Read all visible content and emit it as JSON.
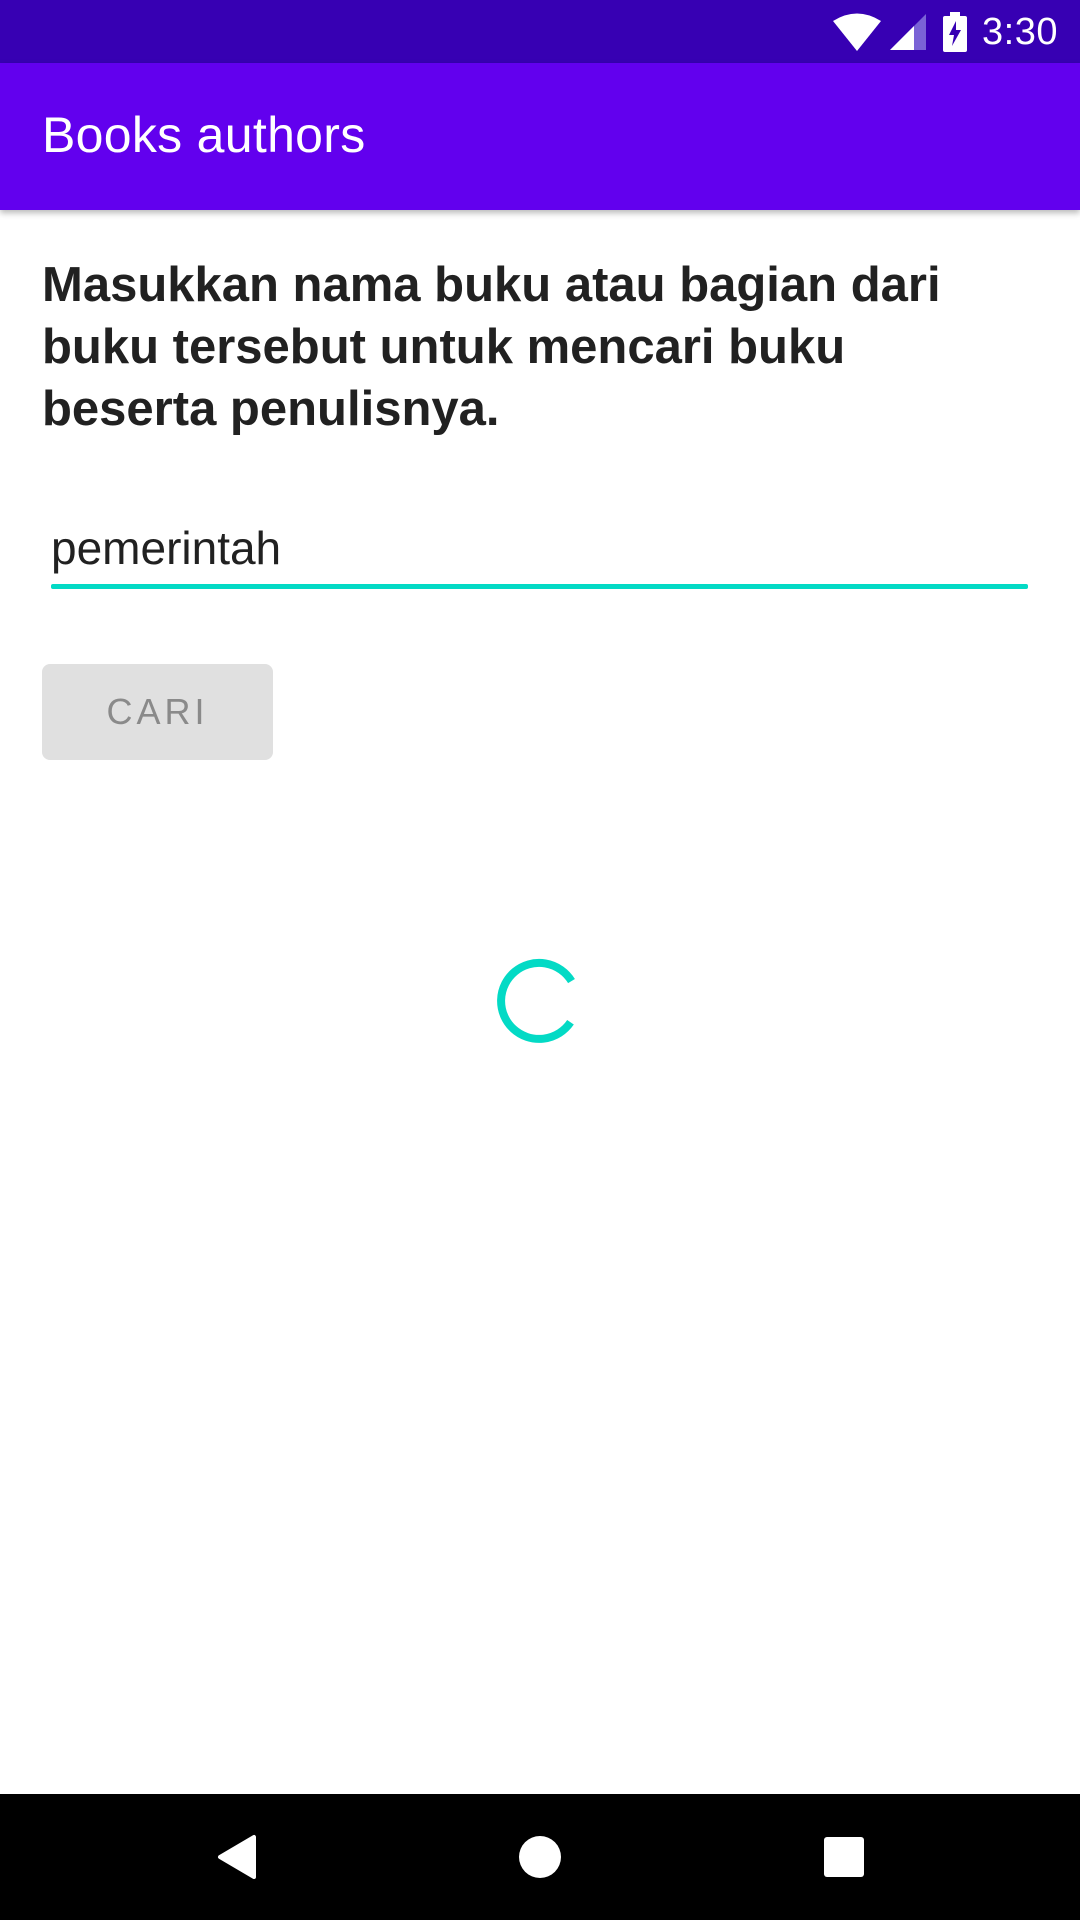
{
  "status_bar": {
    "time": "3:30",
    "icons": [
      "wifi-icon",
      "cell-signal-icon",
      "battery-charging-icon"
    ],
    "color": "#3700b3"
  },
  "app_bar": {
    "title": "Books authors",
    "color": "#6200ee"
  },
  "main": {
    "instruction": "Masukkan nama buku atau bagian dari buku tersebut untuk mencari buku beserta penulisnya.",
    "search_input": {
      "value": "pemerintah",
      "placeholder": ""
    },
    "search_button_label": "CARI",
    "loading": true,
    "accent_color": "#03dac5"
  },
  "nav_bar": {
    "buttons": [
      "back-icon",
      "home-icon",
      "recents-icon"
    ]
  }
}
